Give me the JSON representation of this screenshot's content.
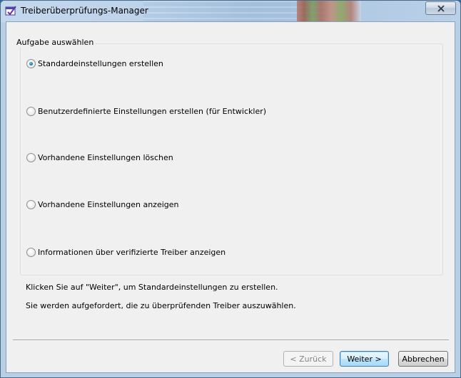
{
  "window": {
    "title": "Treiberüberprüfungs-Manager",
    "close_symbol": "✕"
  },
  "group": {
    "legend": "Aufgabe auswählen",
    "options": [
      {
        "label": "Standardeinstellungen erstellen",
        "checked": true
      },
      {
        "label": "Benutzerdefinierte Einstellungen erstellen (für Entwickler)",
        "checked": false
      },
      {
        "label": "Vorhandene Einstellungen löschen",
        "checked": false
      },
      {
        "label": "Vorhandene Einstellungen anzeigen",
        "checked": false
      },
      {
        "label": "Informationen über verifizierte Treiber anzeigen",
        "checked": false
      }
    ]
  },
  "info": {
    "line1": "Klicken Sie auf \"Weiter\", um Standardeinstellungen zu erstellen.",
    "line2": "Sie werden aufgefordert, die zu überprüfenden Treiber auszuwählen."
  },
  "buttons": {
    "back": "< Zurück",
    "next": "Weiter >",
    "cancel": "Abbrechen"
  },
  "colors": {
    "radio_selected": "#1a72b8",
    "dialog_background": "#f0f0f0"
  }
}
